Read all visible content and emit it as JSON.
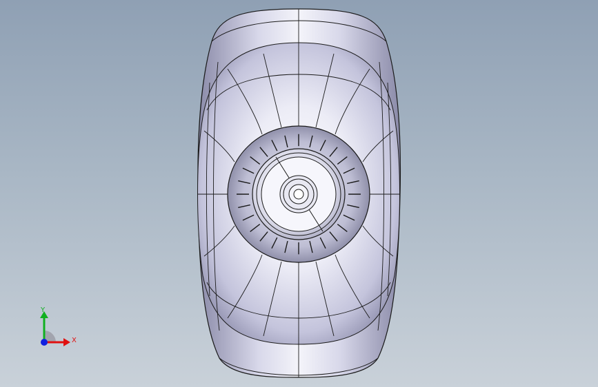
{
  "viewport": {
    "background_top": "#8fa0b4",
    "background_bottom": "#c9d1d9"
  },
  "model": {
    "icon": "wheel-tire-3d-model",
    "body_color": "#d4d4e8",
    "edge_color": "#1a1a1a"
  },
  "triad": {
    "x_label": "X",
    "y_label": "Y",
    "x_color": "#e01010",
    "y_color": "#10b020",
    "z_color": "#1020e0"
  }
}
